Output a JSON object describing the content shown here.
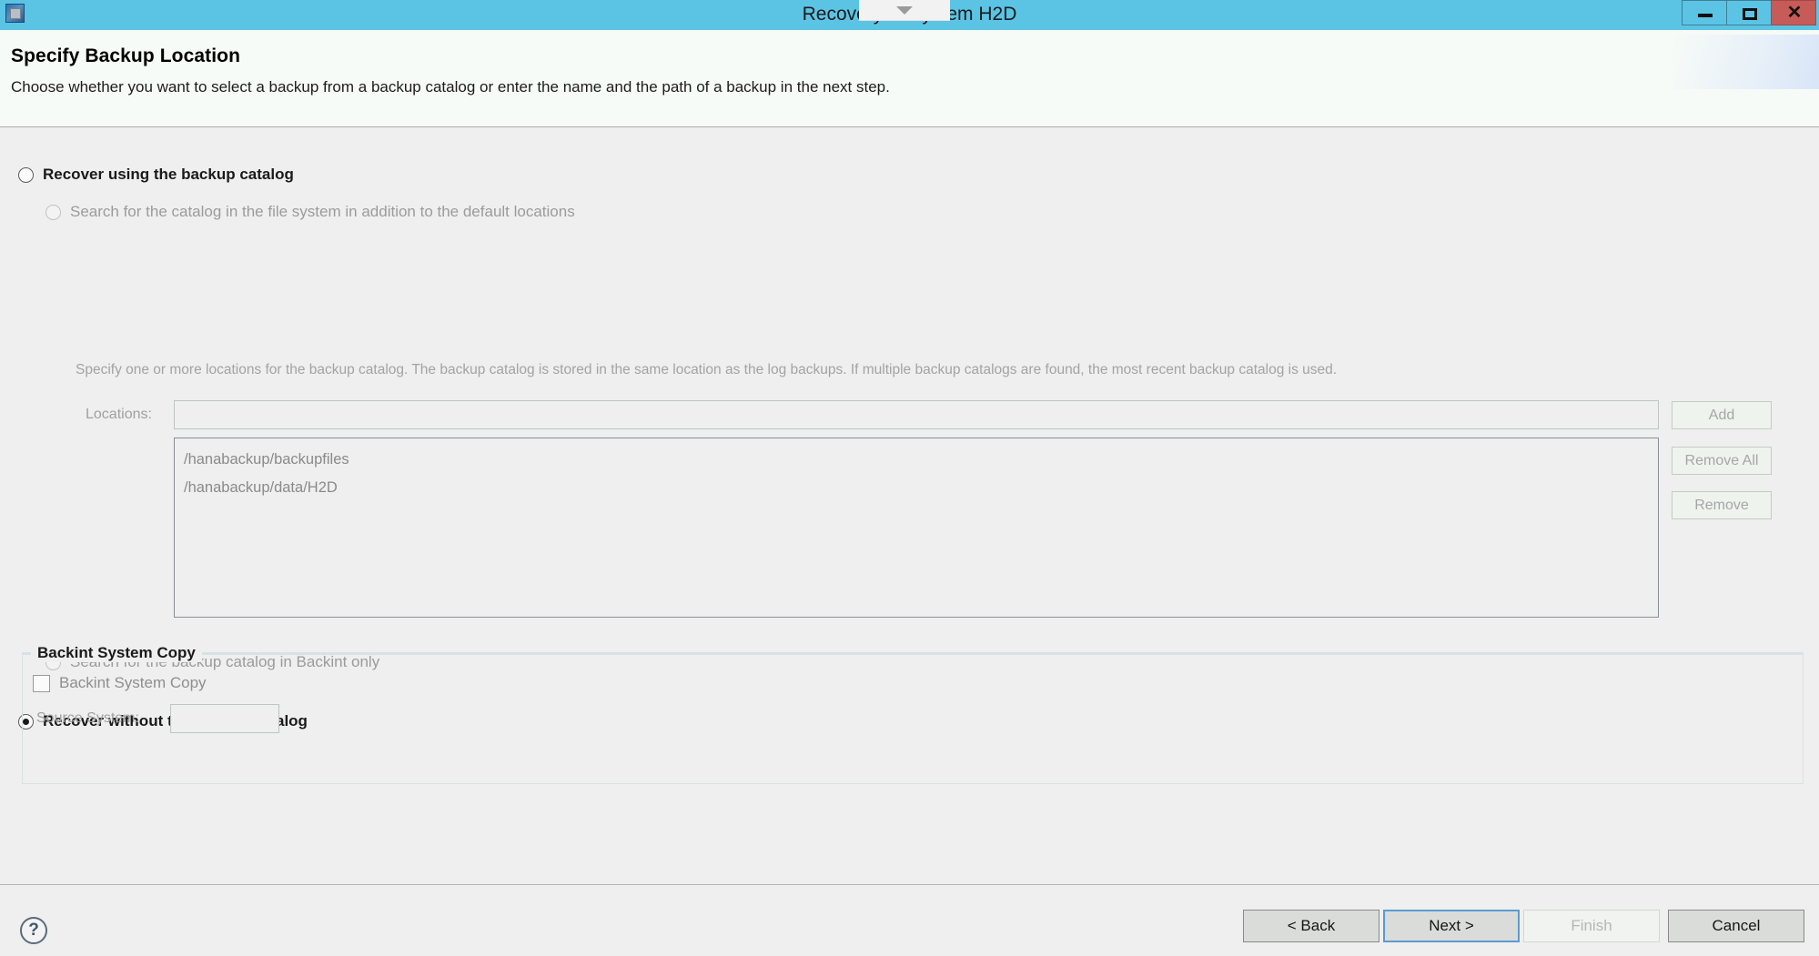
{
  "window": {
    "title": "Recovery of System H2D",
    "icon": "system-window-icon",
    "minimize_label": "—",
    "maximize_label": "☐",
    "close_label": "✕"
  },
  "wizard": {
    "title": "Specify Backup Location",
    "subtitle": "Choose whether you want to select a backup from a backup catalog or enter the name and the path of a backup in the next step."
  },
  "options": {
    "use_catalog": {
      "label": "Recover using the backup catalog",
      "checked": false
    },
    "search_filesystem": {
      "label": "Search for the catalog in the file system in addition to the default locations",
      "checked": false,
      "disabled": true
    },
    "search_filesystem_help": "Specify one or more locations for the backup catalog. The backup catalog is stored in the same location as the log backups. If multiple backup catalogs are found, the most recent backup catalog is used.",
    "search_backint_only": {
      "label": "Search for the backup catalog in Backint only",
      "checked": false,
      "disabled": true
    },
    "without_catalog": {
      "label": "Recover without the backup catalog",
      "checked": true
    }
  },
  "locations": {
    "label": "Locations:",
    "input_value": "",
    "input_placeholder": "",
    "items": [
      "/hanabackup/backupfiles",
      "/hanabackup/data/H2D"
    ],
    "buttons": {
      "add": "Add",
      "remove_all": "Remove All",
      "remove": "Remove"
    }
  },
  "backint_group": {
    "legend": "Backint System Copy",
    "checkbox_label": "Backint System Copy",
    "checkbox_checked": false,
    "source_system_label": "Source System:",
    "source_system_value": ""
  },
  "footer": {
    "help_label": "?",
    "back": "< Back",
    "next": "Next >",
    "finish": "Finish",
    "cancel": "Cancel"
  },
  "colors": {
    "titlebar": "#5bc4e4",
    "close_button": "#c75b57",
    "focus_border": "#5b9bd5",
    "body_background": "#efefef",
    "header_background": "#f7fbf7"
  }
}
